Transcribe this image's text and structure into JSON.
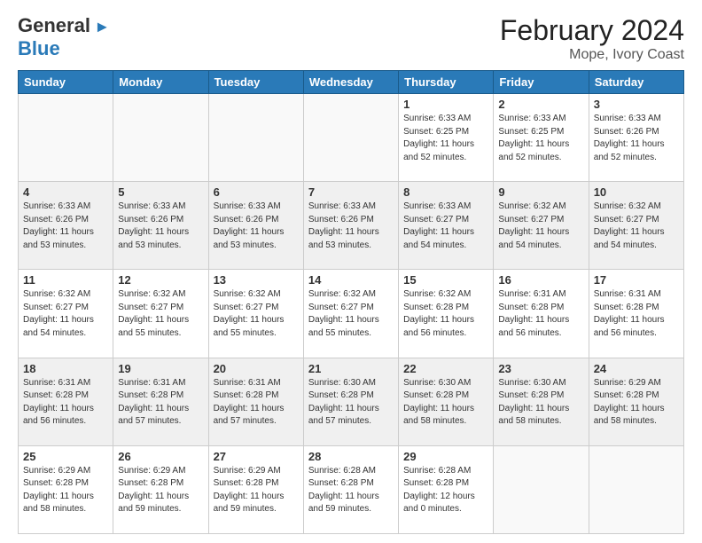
{
  "header": {
    "logo_line1": "General",
    "logo_line2": "Blue",
    "title": "February 2024",
    "subtitle": "Mope, Ivory Coast"
  },
  "days_of_week": [
    "Sunday",
    "Monday",
    "Tuesday",
    "Wednesday",
    "Thursday",
    "Friday",
    "Saturday"
  ],
  "weeks": [
    [
      {
        "day": "",
        "info": ""
      },
      {
        "day": "",
        "info": ""
      },
      {
        "day": "",
        "info": ""
      },
      {
        "day": "",
        "info": ""
      },
      {
        "day": "1",
        "info": "Sunrise: 6:33 AM\nSunset: 6:25 PM\nDaylight: 11 hours\nand 52 minutes."
      },
      {
        "day": "2",
        "info": "Sunrise: 6:33 AM\nSunset: 6:25 PM\nDaylight: 11 hours\nand 52 minutes."
      },
      {
        "day": "3",
        "info": "Sunrise: 6:33 AM\nSunset: 6:26 PM\nDaylight: 11 hours\nand 52 minutes."
      }
    ],
    [
      {
        "day": "4",
        "info": "Sunrise: 6:33 AM\nSunset: 6:26 PM\nDaylight: 11 hours\nand 53 minutes."
      },
      {
        "day": "5",
        "info": "Sunrise: 6:33 AM\nSunset: 6:26 PM\nDaylight: 11 hours\nand 53 minutes."
      },
      {
        "day": "6",
        "info": "Sunrise: 6:33 AM\nSunset: 6:26 PM\nDaylight: 11 hours\nand 53 minutes."
      },
      {
        "day": "7",
        "info": "Sunrise: 6:33 AM\nSunset: 6:26 PM\nDaylight: 11 hours\nand 53 minutes."
      },
      {
        "day": "8",
        "info": "Sunrise: 6:33 AM\nSunset: 6:27 PM\nDaylight: 11 hours\nand 54 minutes."
      },
      {
        "day": "9",
        "info": "Sunrise: 6:32 AM\nSunset: 6:27 PM\nDaylight: 11 hours\nand 54 minutes."
      },
      {
        "day": "10",
        "info": "Sunrise: 6:32 AM\nSunset: 6:27 PM\nDaylight: 11 hours\nand 54 minutes."
      }
    ],
    [
      {
        "day": "11",
        "info": "Sunrise: 6:32 AM\nSunset: 6:27 PM\nDaylight: 11 hours\nand 54 minutes."
      },
      {
        "day": "12",
        "info": "Sunrise: 6:32 AM\nSunset: 6:27 PM\nDaylight: 11 hours\nand 55 minutes."
      },
      {
        "day": "13",
        "info": "Sunrise: 6:32 AM\nSunset: 6:27 PM\nDaylight: 11 hours\nand 55 minutes."
      },
      {
        "day": "14",
        "info": "Sunrise: 6:32 AM\nSunset: 6:27 PM\nDaylight: 11 hours\nand 55 minutes."
      },
      {
        "day": "15",
        "info": "Sunrise: 6:32 AM\nSunset: 6:28 PM\nDaylight: 11 hours\nand 56 minutes."
      },
      {
        "day": "16",
        "info": "Sunrise: 6:31 AM\nSunset: 6:28 PM\nDaylight: 11 hours\nand 56 minutes."
      },
      {
        "day": "17",
        "info": "Sunrise: 6:31 AM\nSunset: 6:28 PM\nDaylight: 11 hours\nand 56 minutes."
      }
    ],
    [
      {
        "day": "18",
        "info": "Sunrise: 6:31 AM\nSunset: 6:28 PM\nDaylight: 11 hours\nand 56 minutes."
      },
      {
        "day": "19",
        "info": "Sunrise: 6:31 AM\nSunset: 6:28 PM\nDaylight: 11 hours\nand 57 minutes."
      },
      {
        "day": "20",
        "info": "Sunrise: 6:31 AM\nSunset: 6:28 PM\nDaylight: 11 hours\nand 57 minutes."
      },
      {
        "day": "21",
        "info": "Sunrise: 6:30 AM\nSunset: 6:28 PM\nDaylight: 11 hours\nand 57 minutes."
      },
      {
        "day": "22",
        "info": "Sunrise: 6:30 AM\nSunset: 6:28 PM\nDaylight: 11 hours\nand 58 minutes."
      },
      {
        "day": "23",
        "info": "Sunrise: 6:30 AM\nSunset: 6:28 PM\nDaylight: 11 hours\nand 58 minutes."
      },
      {
        "day": "24",
        "info": "Sunrise: 6:29 AM\nSunset: 6:28 PM\nDaylight: 11 hours\nand 58 minutes."
      }
    ],
    [
      {
        "day": "25",
        "info": "Sunrise: 6:29 AM\nSunset: 6:28 PM\nDaylight: 11 hours\nand 58 minutes."
      },
      {
        "day": "26",
        "info": "Sunrise: 6:29 AM\nSunset: 6:28 PM\nDaylight: 11 hours\nand 59 minutes."
      },
      {
        "day": "27",
        "info": "Sunrise: 6:29 AM\nSunset: 6:28 PM\nDaylight: 11 hours\nand 59 minutes."
      },
      {
        "day": "28",
        "info": "Sunrise: 6:28 AM\nSunset: 6:28 PM\nDaylight: 11 hours\nand 59 minutes."
      },
      {
        "day": "29",
        "info": "Sunrise: 6:28 AM\nSunset: 6:28 PM\nDaylight: 12 hours\nand 0 minutes."
      },
      {
        "day": "",
        "info": ""
      },
      {
        "day": "",
        "info": ""
      }
    ]
  ]
}
